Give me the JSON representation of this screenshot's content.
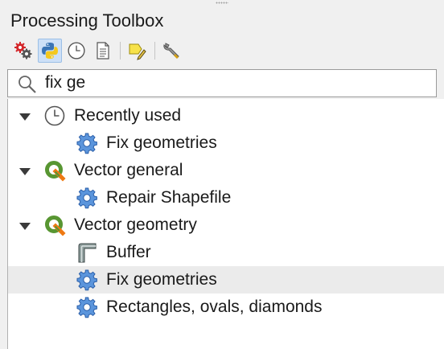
{
  "panel": {
    "title": "Processing Toolbox"
  },
  "toolbar": {
    "items": [
      {
        "icon": "models-gear-icon",
        "tooltip": "Models"
      },
      {
        "icon": "python-icon",
        "tooltip": "Scripts"
      },
      {
        "icon": "history-clock-icon",
        "tooltip": "History"
      },
      {
        "icon": "results-document-icon",
        "tooltip": "Results Viewer"
      },
      {
        "icon": "edit-features-in-place-icon",
        "tooltip": "Edit Features In-Place"
      },
      {
        "icon": "options-wrench-icon",
        "tooltip": "Options"
      }
    ]
  },
  "search": {
    "value": "fix ge",
    "placeholder": "Search..."
  },
  "tree": {
    "groups": [
      {
        "label": "Recently used",
        "icon": "clock-icon",
        "expanded": true,
        "items": [
          {
            "label": "Fix geometries",
            "icon": "gear-icon"
          }
        ]
      },
      {
        "label": "Vector general",
        "icon": "qgis-icon",
        "expanded": true,
        "items": [
          {
            "label": "Repair Shapefile",
            "icon": "gear-icon"
          }
        ]
      },
      {
        "label": "Vector geometry",
        "icon": "qgis-icon",
        "expanded": true,
        "items": [
          {
            "label": "Buffer",
            "icon": "buffer-icon"
          },
          {
            "label": "Fix geometries",
            "icon": "gear-icon",
            "selected": true
          },
          {
            "label": "Rectangles, ovals, diamonds",
            "icon": "gear-icon"
          }
        ]
      }
    ]
  },
  "colors": {
    "selection": "#ebebeb",
    "gear": "#3e7bcf",
    "qgis_green": "#5bab2e"
  }
}
